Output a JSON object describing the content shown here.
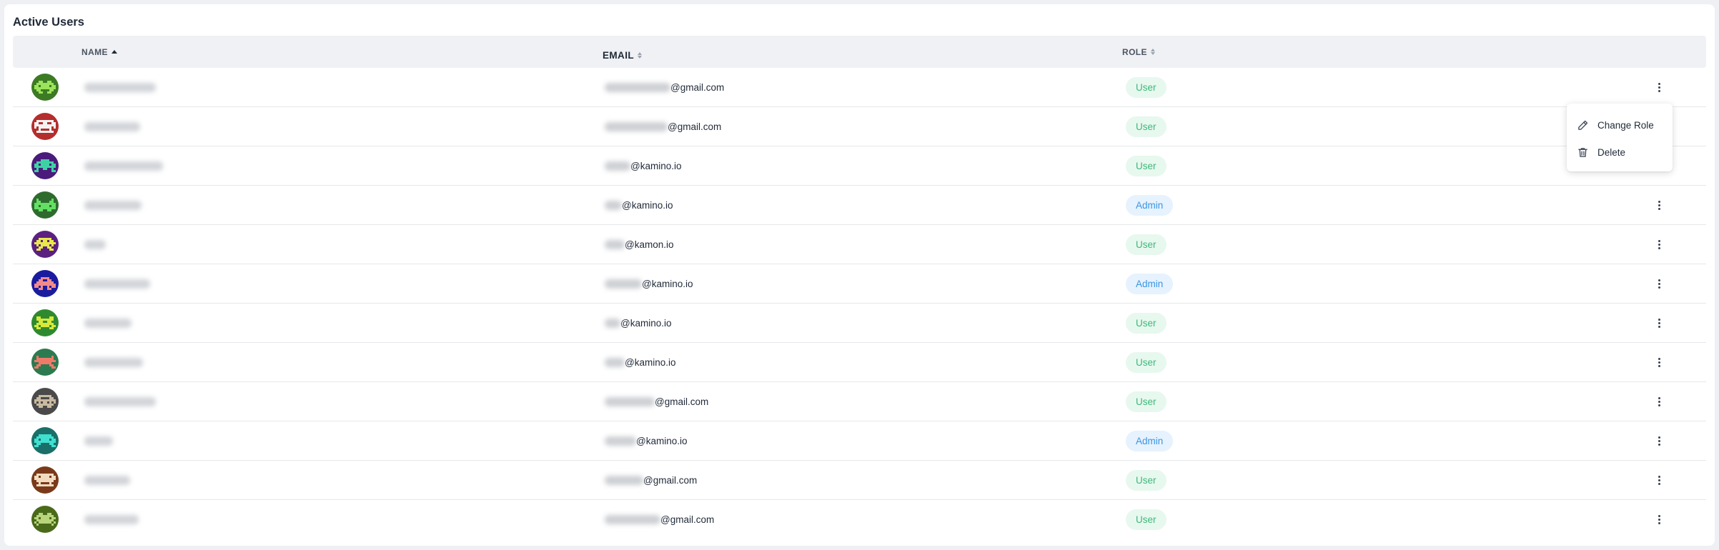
{
  "title": "Active Users",
  "columns": {
    "name": "NAME",
    "email": "EMAIL",
    "role": "ROLE"
  },
  "rows": [
    {
      "email_domain": "@gmail.com",
      "role": "User",
      "role_type": "user",
      "avatar_color": "#3d7a24"
    },
    {
      "email_domain": "@gmail.com",
      "role": "User",
      "role_type": "user",
      "avatar_color": "#b52d2d"
    },
    {
      "email_domain": "@kamino.io",
      "role": "User",
      "role_type": "user",
      "avatar_color": "#4a1b7a"
    },
    {
      "email_domain": "@kamino.io",
      "role": "Admin",
      "role_type": "admin",
      "avatar_color": "#2f6b2f"
    },
    {
      "email_domain": "@kamon.io",
      "role": "User",
      "role_type": "user",
      "avatar_color": "#5b2080"
    },
    {
      "email_domain": "@kamino.io",
      "role": "Admin",
      "role_type": "admin",
      "avatar_color": "#1b1ba0"
    },
    {
      "email_domain": "@kamino.io",
      "role": "User",
      "role_type": "user",
      "avatar_color": "#2f8a2f"
    },
    {
      "email_domain": "@kamino.io",
      "role": "User",
      "role_type": "user",
      "avatar_color": "#2c7a50"
    },
    {
      "email_domain": "@gmail.com",
      "role": "User",
      "role_type": "user",
      "avatar_color": "#4a4a4a"
    },
    {
      "email_domain": "@kamino.io",
      "role": "Admin",
      "role_type": "admin",
      "avatar_color": "#1a6f68"
    },
    {
      "email_domain": "@gmail.com",
      "role": "User",
      "role_type": "user",
      "avatar_color": "#7a3a1a"
    },
    {
      "email_domain": "@gmail.com",
      "role": "User",
      "role_type": "user",
      "avatar_color": "#4a6a1a"
    }
  ],
  "menu": {
    "change_role": "Change Role",
    "delete": "Delete"
  },
  "colors": {
    "user_badge": "#3fb879",
    "admin_badge": "#3b95e3"
  }
}
